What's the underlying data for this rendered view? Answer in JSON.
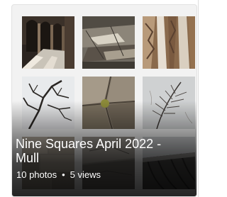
{
  "album": {
    "title": "Nine Squares April 2022 - Mull",
    "photos": "10 photos",
    "separator": "•",
    "views": "5 views"
  },
  "thumbnails": [
    {
      "icon": "cloister-arches-photo"
    },
    {
      "icon": "ruined-wall-photo"
    },
    {
      "icon": "bark-texture-photo"
    },
    {
      "icon": "bare-branches-photo"
    },
    {
      "icon": "stone-slab-photo"
    },
    {
      "icon": "feather-grass-photo"
    },
    {
      "icon": "stonework-photo"
    },
    {
      "icon": "grey-rock-photo"
    },
    {
      "icon": "boat-hull-photo"
    }
  ]
}
